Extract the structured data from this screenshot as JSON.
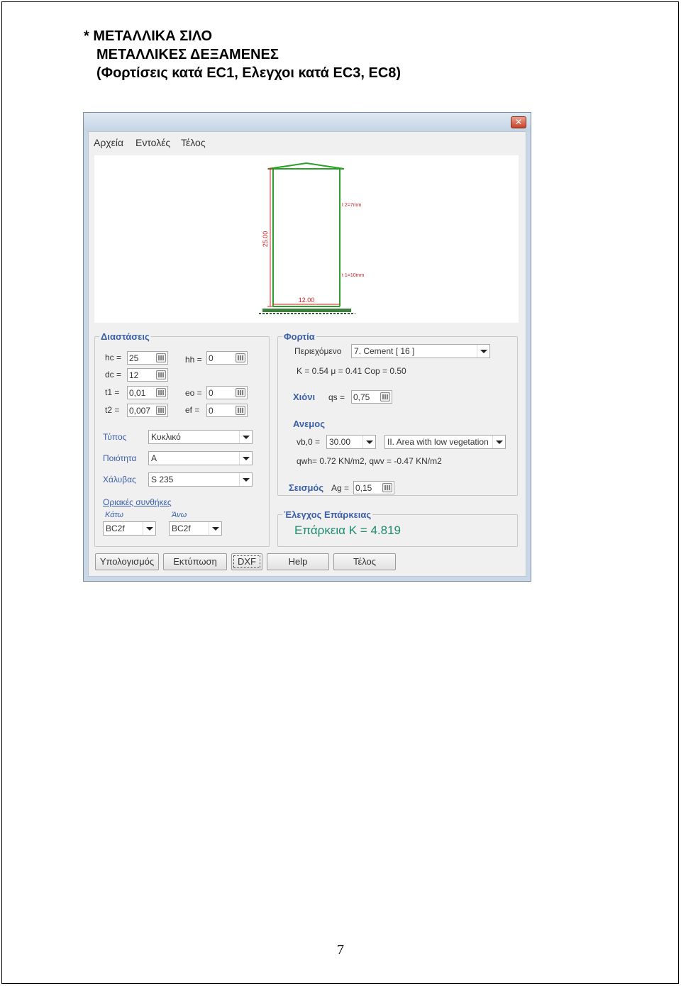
{
  "document": {
    "title_line1": "* ΜΕΤΑΛΛΙΚΑ ΣΙΛΟ",
    "title_line2": "ΜΕΤΑΛΛΙΚΕΣ ΔΕΞΑΜΕΝΕΣ",
    "title_line3": "(Φορτίσεις κατά EC1, Ελεγχοι κατά EC3, EC8)",
    "page_number": "7"
  },
  "window": {
    "close_glyph": "✕",
    "menu": [
      "Αρχεία",
      "Εντολές",
      "Τέλος"
    ]
  },
  "drawing": {
    "height_label": "25.00",
    "diameter_label": "12.00",
    "t2_label": "t 2=7mm",
    "t1_label": "t 1=10mm",
    "colors": {
      "silo": "#2aa02a",
      "roof": "#2aa02a",
      "dimension": "#d62020",
      "base": "#3f7f3f"
    }
  },
  "dimensions": {
    "title": "Διαστάσεις",
    "hc_label": "hc =",
    "hc_value": "25",
    "dc_label": "dc =",
    "dc_value": "12",
    "t1_label": "t1 =",
    "t1_value": "0,01",
    "t2_label": "t2 =",
    "t2_value": "0,007",
    "hh_label": "hh =",
    "hh_value": "0",
    "eo_label": "eo =",
    "eo_value": "0",
    "ef_label": "ef =",
    "ef_value": "0",
    "type_label": "Τύπος",
    "type_value": "Κυκλικό",
    "quality_label": "Ποιότητα",
    "quality_value": "A",
    "steel_label": "Χάλυβας",
    "steel_value": "S 235",
    "boundary_link": "Οριακές συνθήκες",
    "bottom_label": "Κάτω",
    "bottom_value": "BC2f",
    "top_label": "Άνω",
    "top_value": "BC2f"
  },
  "loads": {
    "title": "Φορτία",
    "content_label": "Περιεχόμενο",
    "content_value": "7. Cement  [ 16 ]",
    "coefficients": "K = 0.54   μ = 0.41   Cop = 0.50",
    "snow_label": "Χιόνι",
    "qs_label": "qs =",
    "qs_value": "0,75",
    "wind_label": "Ανεμος",
    "vb_label": "vb,0 =",
    "vb_value": "30.00",
    "terrain_value": "II. Area with low vegetation",
    "wind_result": "qwh= 0.72 KN/m2,   qwv = -0.47 KN/m2",
    "seismic_label": "Σεισμός",
    "ag_label": "Ag =",
    "ag_value": "0,15"
  },
  "checks": {
    "title": "Έλεγχος Επάρκειας",
    "result": "Επάρκεια K = 4.819",
    "result_color": "#1e8c6e"
  },
  "buttons": {
    "calculate": "Υπολογισμός",
    "print": "Εκτύπωση",
    "dxf": "DXF",
    "help": "Help",
    "end": "Τέλος"
  }
}
